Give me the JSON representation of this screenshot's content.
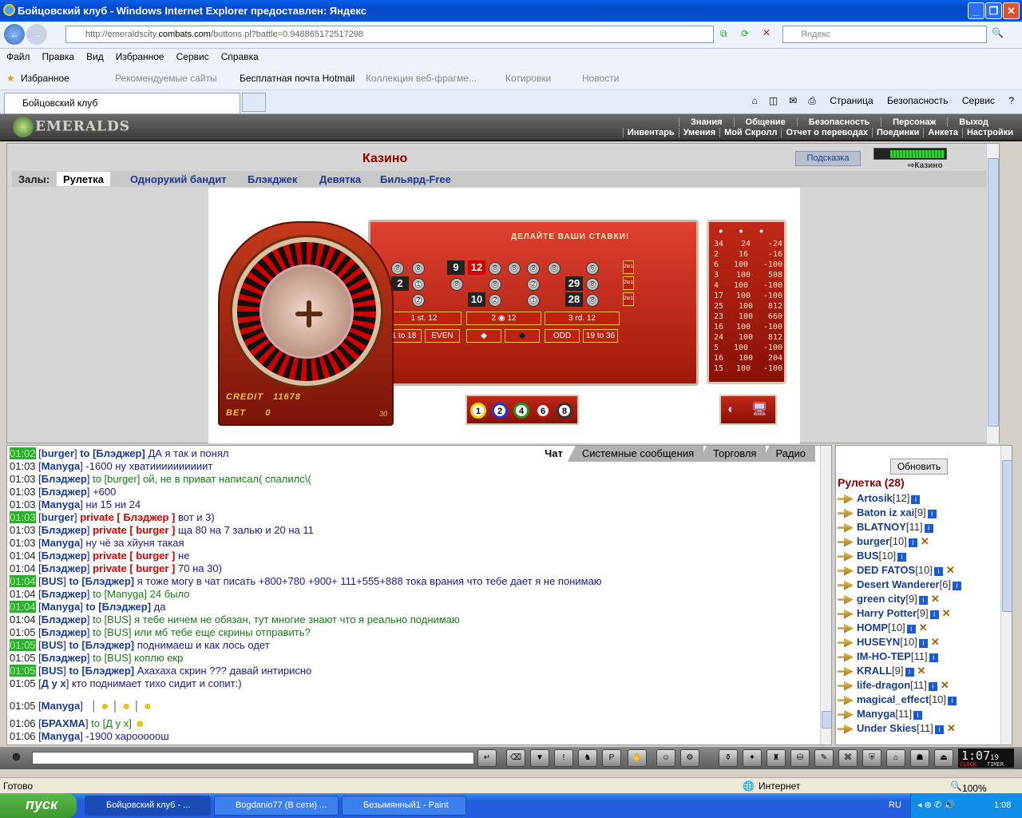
{
  "window": {
    "title": "Бойцовский клуб - Windows Internet Explorer предоставлен: Яндекс"
  },
  "address": {
    "url_prefix": "http://emeraldscity.",
    "url_domain": "combats.com",
    "url_path": "/buttons.pl?battle=0.948865172517298",
    "search_placeholder": "Яндекс"
  },
  "menu": [
    "Файл",
    "Правка",
    "Вид",
    "Избранное",
    "Сервис",
    "Справка"
  ],
  "favorites": {
    "label": "Избранное",
    "items": [
      "Рекомендуемые сайты",
      "Бесплатная почта Hotmail",
      "Коллекция веб-фрагме...",
      "Котировки",
      "Новости"
    ]
  },
  "tab": {
    "title": "Бойцовский клуб"
  },
  "commands": [
    "Страница",
    "Безопасность",
    "Сервис"
  ],
  "game": {
    "logo": "EMERALDS",
    "nav_top": [
      "Знания",
      "Общение",
      "Безопасность",
      "Персонаж",
      "Выход"
    ],
    "nav_bottom": [
      "Инвентарь",
      "Умения",
      "Мой Скролл",
      "Отчет о переводах",
      "Поединки",
      "Анкета",
      "Настройки"
    ],
    "title": "Казино",
    "hint": "Подсказка",
    "location": "Казино",
    "halls_label": "Залы:",
    "halls": [
      "Рулетка",
      "Однорукий бандит",
      "Блэкджек",
      "Девятка",
      "Бильярд-Free"
    ],
    "board_title": "ДЕЛАЙТЕ ВАШИ СТАВКИ!",
    "credit_label": "CREDIT",
    "credit": "11678",
    "bet_label": "BET",
    "bet": "0",
    "wheel_note": "30",
    "numbers": [
      "9",
      "12",
      "2",
      "29",
      "10",
      "28"
    ],
    "dozens": [
      "1 st. 12",
      "2",
      "12",
      "3 rd. 12"
    ],
    "outside": [
      "1 to 18",
      "EVEN",
      "ODD",
      "19 to 36"
    ],
    "columns": [
      "2to1",
      "2to1",
      "2to1"
    ],
    "chips": [
      "1",
      "2",
      "4",
      "6",
      "8"
    ],
    "results": [
      [
        "34",
        "24",
        "-24"
      ],
      [
        "2",
        "16",
        "-16"
      ],
      [
        "6",
        "100",
        "-100"
      ],
      [
        "3",
        "100",
        "508"
      ],
      [
        "4",
        "100",
        "-100"
      ],
      [
        "17",
        "100",
        "-100"
      ],
      [
        "25",
        "100",
        "812"
      ],
      [
        "23",
        "100",
        "660"
      ],
      [
        "16",
        "100",
        "-100"
      ],
      [
        "24",
        "100",
        "812"
      ],
      [
        "5",
        "100",
        "-100"
      ],
      [
        "16",
        "100",
        "204"
      ],
      [
        "15",
        "100",
        "-100"
      ]
    ]
  },
  "chat": {
    "tabs": [
      "Чат",
      "Системные сообщения",
      "Торговля",
      "Радио"
    ],
    "messages": [
      {
        "time": "01:02",
        "hl": true,
        "name": "burger",
        "to": "to [Блэджер]",
        "text": "ДА я так и понял"
      },
      {
        "time": "01:03",
        "name": "Manyga",
        "text": "-1600 ну хватиииииииииит"
      },
      {
        "time": "01:03",
        "name": "Блэджер",
        "to": "to [burger]",
        "text": "ой, не в приват написал( спалилс\\("
      },
      {
        "time": "01:03",
        "name": "Блэджер",
        "text": "+600"
      },
      {
        "time": "01:03",
        "name": "Manyga",
        "text": "ни 15 ни 24"
      },
      {
        "time": "01:03",
        "hl": true,
        "name": "burger",
        "priv": "private [ Блэджер ]",
        "text": "вот и 3)"
      },
      {
        "time": "01:03",
        "name": "Блэджер",
        "priv": "private [ burger ]",
        "text": "ща 80 на 7 залью и 20 на 11"
      },
      {
        "time": "01:03",
        "name": "Manyga",
        "text": "ну чё за хйуня такая"
      },
      {
        "time": "01:04",
        "name": "Блэджер",
        "priv": "private [ burger ]",
        "text": "не"
      },
      {
        "time": "01:04",
        "name": "Блэджер",
        "priv": "private [ burger ]",
        "text": "70 на 30)"
      },
      {
        "time": "01:04",
        "hl": true,
        "name": "BUS",
        "to": "to [Блэджер]",
        "text": "я тоже могу в чат писать +800+780 +900+ 111+555+888 тока врания что тебе дает я не понимаю"
      },
      {
        "time": "01:04",
        "name": "Блэджер",
        "to": "to [Manyga]",
        "text": "24 было"
      },
      {
        "time": "01:04",
        "hl": true,
        "name": "Manyga",
        "to": "to [Блэджер]",
        "text": "да"
      },
      {
        "time": "01:04",
        "name": "Блэджер",
        "to": "to [BUS]",
        "text": "я тебе ничем не обязан, тут многие знают что я реально поднимаю"
      },
      {
        "time": "01:05",
        "name": "Блэджер",
        "to": "to [BUS]",
        "text": "или мб тебе еще скрины отправить?"
      },
      {
        "time": "01:05",
        "hl": true,
        "name": "BUS",
        "to": "to [Блэджер]",
        "text": "поднимаеш и как лось одет"
      },
      {
        "time": "01:05",
        "name": "Блэджер",
        "to": "to [BUS]",
        "text": "коплю екр"
      },
      {
        "time": "01:05",
        "hl": true,
        "name": "BUS",
        "to": "to [Блэджер]",
        "text": "Ахахаха скрин ??? давай интирисно"
      },
      {
        "time": "01:05",
        "name": "Д у х",
        "text": "кто поднимает тихо сидит и сопит:)"
      },
      {
        "time": "01:05",
        "name": "Manyga",
        "text": ""
      },
      {
        "time": "01:06",
        "name": "БРАХМА",
        "to": "to [Д у х]",
        "text": ""
      },
      {
        "time": "01:06",
        "name": "Manyga",
        "text": "-1900 харооооош"
      }
    ]
  },
  "users": {
    "refresh": "Обновить",
    "room": "Рулетка (28)",
    "list": [
      {
        "name": "Artosik",
        "level": "[12]"
      },
      {
        "name": "Baton iz xai",
        "level": "[9]"
      },
      {
        "name": "BLATNOY",
        "level": "[11]"
      },
      {
        "name": "burger",
        "level": "[10]",
        "x": true
      },
      {
        "name": "BUS",
        "level": "[10]"
      },
      {
        "name": "DED FATOS",
        "level": "[10]",
        "x": true
      },
      {
        "name": "Desert Wanderer",
        "level": "[6]"
      },
      {
        "name": "green city",
        "level": "[9]",
        "x": true
      },
      {
        "name": "Harry Potter",
        "level": "[9]",
        "x": true
      },
      {
        "name": "HOMP",
        "level": "[10]",
        "x": true
      },
      {
        "name": "HUSEYN",
        "level": "[10]",
        "x": true
      },
      {
        "name": "IM-HO-TEP",
        "level": "[11]"
      },
      {
        "name": "KRALL",
        "level": "[9]",
        "x": true
      },
      {
        "name": "life-dragon",
        "level": "[11]",
        "x": true
      },
      {
        "name": "magical_effect",
        "level": "[10]"
      },
      {
        "name": "Manyga",
        "level": "[11]"
      },
      {
        "name": "Under Skies",
        "level": "[11]",
        "x": true
      }
    ]
  },
  "clock": {
    "time": "1:07",
    "sec": "19",
    "l1": "CLOCK",
    "l2": "TIMER"
  },
  "status": {
    "left": "Готово",
    "zone": "Интернет",
    "zoom": "100%"
  },
  "taskbar": {
    "start": "пуск",
    "tasks": [
      "Бойцовский клуб - ...",
      "Bogdanio77 (В сети) ...",
      "Безымянный1 - Paint"
    ],
    "lang": "RU",
    "time": "1:08"
  }
}
